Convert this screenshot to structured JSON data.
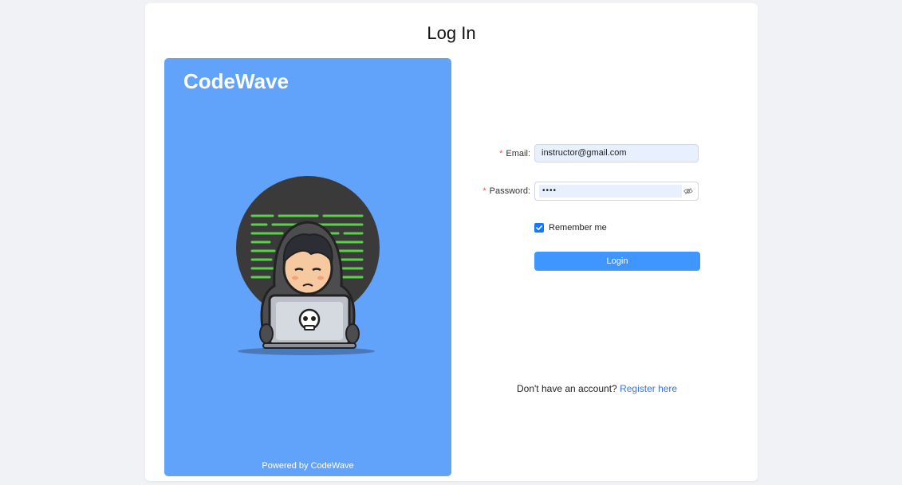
{
  "page": {
    "title": "Log In"
  },
  "brand": {
    "name": "CodeWave",
    "powered_by": "Powered by CodeWave",
    "illustration": "hacker-with-laptop-illustration",
    "panel_color": "#61a3fa"
  },
  "form": {
    "email": {
      "label": "Email",
      "value": "instructor@gmail.com",
      "required": true
    },
    "password": {
      "label": "Password",
      "value_masked": "••••",
      "required": true,
      "toggle_icon": "eye-invisible-icon"
    },
    "remember": {
      "label": "Remember me",
      "checked": true
    },
    "submit_label": "Login"
  },
  "register": {
    "prompt": "Don't have an account?",
    "link_label": "Register here"
  },
  "colors": {
    "accent": "#4096ff",
    "link": "#3b74d8",
    "required_star": "#ff4d4f"
  }
}
